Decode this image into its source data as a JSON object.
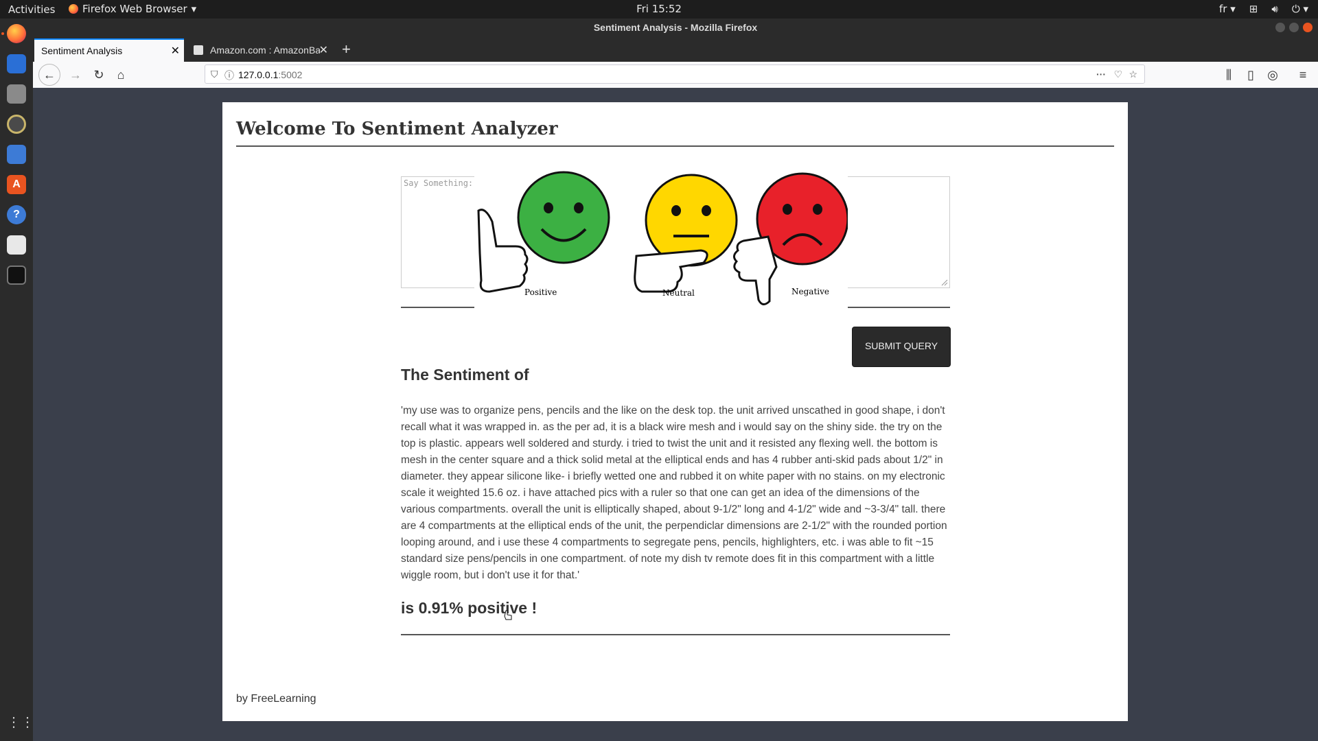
{
  "topbar": {
    "activities": "Activities",
    "app_menu": "Firefox Web Browser",
    "clock": "Fri 15:52",
    "language": "fr"
  },
  "window": {
    "title": "Sentiment Analysis - Mozilla Firefox"
  },
  "tabs": [
    {
      "label": "Sentiment Analysis",
      "active": true
    },
    {
      "label": "Amazon.com : AmazonBasics",
      "active": false
    }
  ],
  "url": {
    "host": "127.0.0.1",
    "port": ":5002"
  },
  "page": {
    "heading": "Welcome To Sentiment Analyzer",
    "textarea_placeholder": "Say Something:",
    "emoji_labels": {
      "positive": "Positive",
      "neutral": "Neutral",
      "negative": "Negative"
    },
    "submit_label": "SUBMIT QUERY",
    "sentiment_title": "The Sentiment of",
    "review_text": "'my use was to organize pens, pencils and the like on the desk top. the unit arrived unscathed in good shape, i don't recall what it was wrapped in. as the per ad, it is a black wire mesh and i would say on the shiny side. the try on the top is plastic. appears well soldered and sturdy. i tried to twist the unit and it resisted any flexing well. the bottom is mesh in the center square and a thick solid metal at the elliptical ends and has 4 rubber anti-skid pads about 1/2\" in diameter. they appear silicone like- i briefly wetted one and rubbed it on white paper with no stains. on my electronic scale it weighted 15.6 oz. i have attached pics with a ruler so that one can get an idea of the dimensions of the various compartments. overall the unit is elliptically shaped, about 9-1/2\" long and 4-1/2\" wide and ~3-3/4\" tall. there are 4 compartments at the elliptical ends of the unit, the perpendiclar dimensions are 2-1/2\" with the rounded portion looping around, and i use these 4 compartments to segregate pens, pencils, highlighters, etc. i was able to fit ~15 standard size pens/pencils in one compartment. of note my dish tv remote does fit in this compartment with a little wiggle room, but i don't use it for that.'",
    "result": "is 0.91% positive !",
    "footer": "by FreeLearning"
  },
  "colors": {
    "positive": "#3cb043",
    "neutral": "#ffd700",
    "negative": "#e8212a",
    "accent": "#e95420"
  }
}
